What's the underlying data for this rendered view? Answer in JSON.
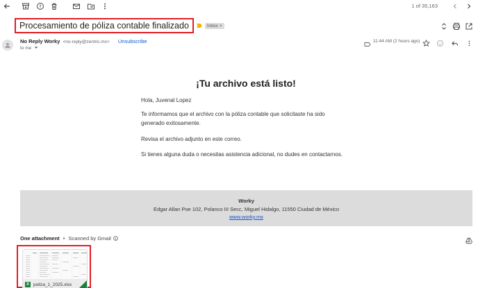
{
  "toolbar": {
    "pager_text": "1 of 35,163"
  },
  "email": {
    "subject": "Procesamiento de póliza contable finalizado",
    "label": "Inbox",
    "label_close": "×",
    "sender_name": "No Reply Worky",
    "sender_email": "<no-reply@zentric.mx>",
    "unsubscribe": "Unsubscribe",
    "to_line": "to me",
    "timestamp": "11:44 AM (2 hours ago)"
  },
  "message": {
    "title": "¡Tu archivo está listo!",
    "greeting": "Hola, Juvenal Lopez",
    "paragraph1": "Te informamos que el archivo con la póliza contable que solicitaste ha sido generado exitosamente.",
    "paragraph2": "Revisa el archivo adjunto en este correo.",
    "paragraph3": "Si tienes alguna duda o necesitas asistencia adicional, no dudes en contactarnos."
  },
  "footer": {
    "company": "Worky",
    "address": "Edgar Allan Poe 102, Polanco III Secc, Miguel Hidalgo, 11550 Ciudad de México",
    "link": "www.worky.mx"
  },
  "attachments": {
    "header": "One attachment",
    "separator": "•",
    "scanned": "Scanned by Gmail",
    "file_badge": "X",
    "file_name": "poliza_1_2025.xlsx"
  },
  "colors": {
    "highlight_border": "#e31b23",
    "link": "#0b57d0",
    "excel_green": "#188038",
    "footer_bg": "#dcdcdc"
  }
}
